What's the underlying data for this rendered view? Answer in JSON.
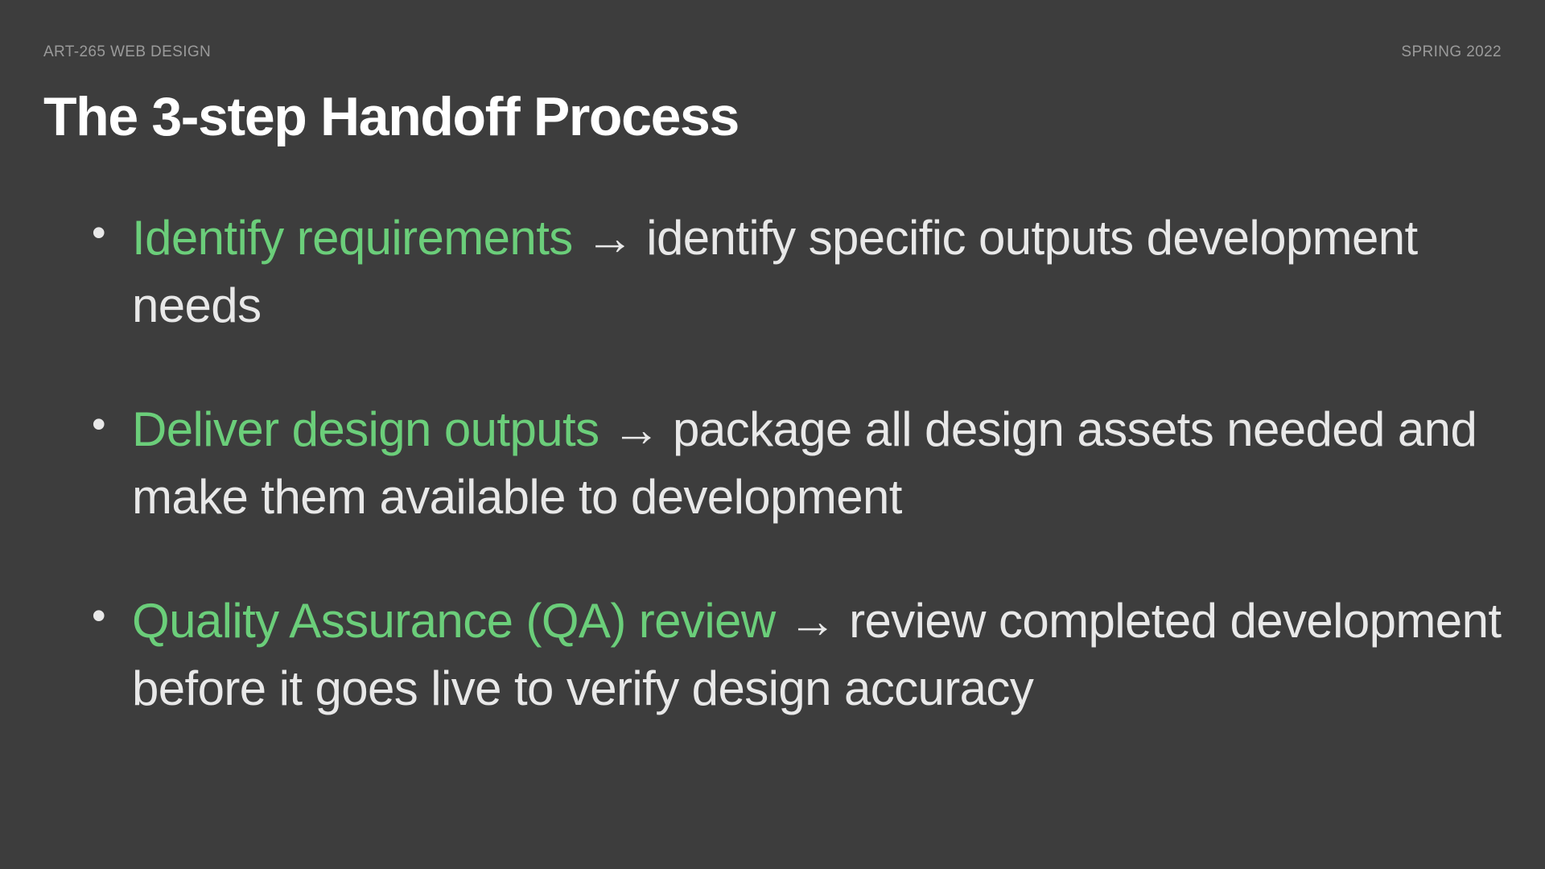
{
  "header": {
    "course": "ART-265 WEB DESIGN",
    "semester": "SPRING 2022"
  },
  "title": "The 3-step Handoff Process",
  "bullets": [
    {
      "highlight": "Identify requirements",
      "arrow": "→",
      "description": "identify specific outputs development needs"
    },
    {
      "highlight": "Deliver design outputs",
      "arrow": "→",
      "description": "package all design assets needed and make them available to development"
    },
    {
      "highlight": "Quality Assurance (QA) review",
      "arrow": "→",
      "description": "review completed development before it goes live to verify design accuracy"
    }
  ]
}
